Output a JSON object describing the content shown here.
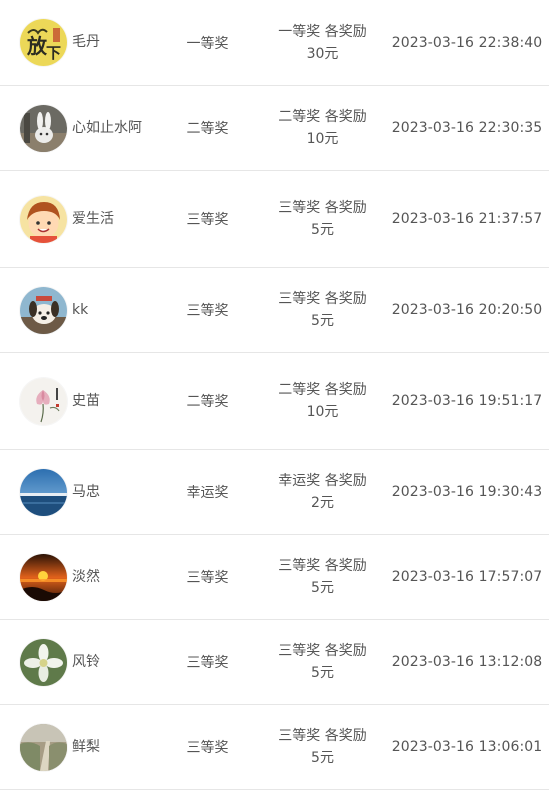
{
  "winners": [
    {
      "avatar_icon": "fangxia-calligraphy-avatar",
      "name": "毛丹",
      "prize": "一等奖",
      "reward_line1": "一等奖 各奖励",
      "reward_line2": "30元",
      "time": "2023-03-16 22:38:40"
    },
    {
      "avatar_icon": "rabbit-photo-avatar",
      "name": "心如止水阿",
      "prize": "二等奖",
      "reward_line1": "二等奖 各奖励",
      "reward_line2": "10元",
      "time": "2023-03-16 22:30:35"
    },
    {
      "avatar_icon": "cartoon-boy-avatar",
      "name": "爱生活",
      "prize": "三等奖",
      "reward_line1": "三等奖 各奖励",
      "reward_line2": "5元",
      "time": "2023-03-16 21:37:57"
    },
    {
      "avatar_icon": "cartoon-dog-avatar",
      "name": "kk",
      "prize": "三等奖",
      "reward_line1": "三等奖 各奖励",
      "reward_line2": "5元",
      "time": "2023-03-16 20:20:50"
    },
    {
      "avatar_icon": "lotus-painting-avatar",
      "name": "史苗",
      "prize": "二等奖",
      "reward_line1": "二等奖 各奖励",
      "reward_line2": "10元",
      "time": "2023-03-16 19:51:17"
    },
    {
      "avatar_icon": "sea-horizon-avatar",
      "name": "马忠",
      "prize": "幸运奖",
      "reward_line1": "幸运奖 各奖励",
      "reward_line2": "2元",
      "time": "2023-03-16 19:30:43"
    },
    {
      "avatar_icon": "sunset-avatar",
      "name": "淡然",
      "prize": "三等奖",
      "reward_line1": "三等奖 各奖励",
      "reward_line2": "5元",
      "time": "2023-03-16 17:57:07"
    },
    {
      "avatar_icon": "white-flower-avatar",
      "name": "风铃",
      "prize": "三等奖",
      "reward_line1": "三等奖 各奖励",
      "reward_line2": "5元",
      "time": "2023-03-16 13:12:08"
    },
    {
      "avatar_icon": "path-landscape-avatar",
      "name": "鲜梨",
      "prize": "三等奖",
      "reward_line1": "三等奖 各奖励",
      "reward_line2": "5元",
      "time": "2023-03-16 13:06:01"
    }
  ]
}
